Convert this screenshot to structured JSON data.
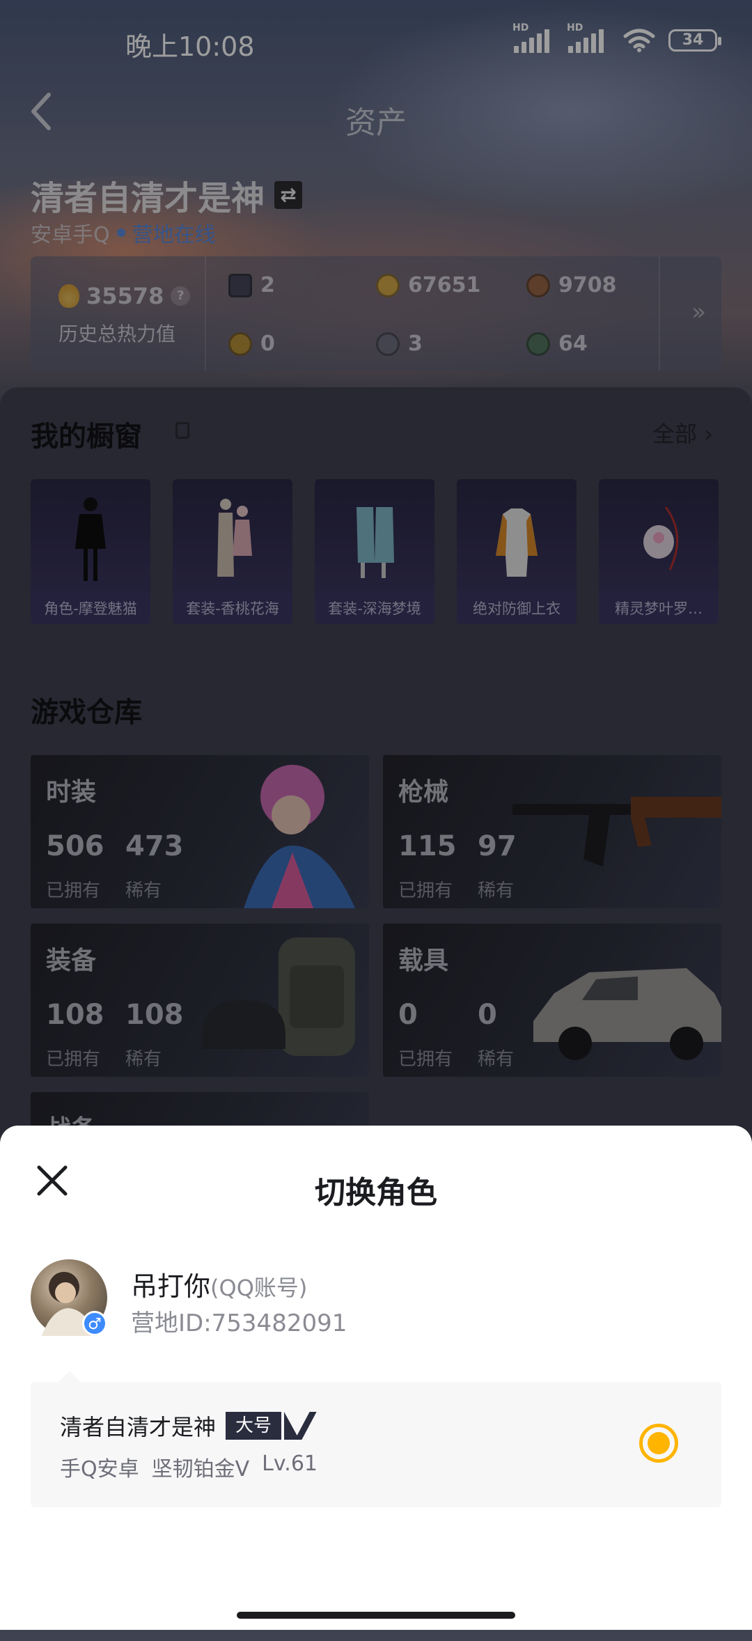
{
  "status_bar": {
    "time": "晚上10:08",
    "battery": "34",
    "sim1": "HD",
    "sim2": "HD"
  },
  "nav": {
    "title": "资产"
  },
  "profile": {
    "name": "清者自清才是神",
    "swap_symbol": "⇄",
    "platform": "安卓手Q",
    "online_status": "营地在线",
    "heat_value": "35578",
    "heat_help": "?",
    "heat_label": "历史总热力值",
    "resources": [
      {
        "icon": "card-icon",
        "value": "2"
      },
      {
        "icon": "gold-coin-icon",
        "value": "67651"
      },
      {
        "icon": "bronze-coin-icon",
        "value": "9708"
      },
      {
        "icon": "badge-coin-icon",
        "value": "0"
      },
      {
        "icon": "silver-coin-icon",
        "value": "3"
      },
      {
        "icon": "green-orb-icon",
        "value": "64"
      }
    ],
    "more_symbol": "»"
  },
  "showcase": {
    "title": "我的橱窗",
    "all_label": "全部",
    "all_chevron": "›",
    "items": [
      {
        "label": "角色-摩登魅猫"
      },
      {
        "label": "套装-香桃花海"
      },
      {
        "label": "套装-深海梦境"
      },
      {
        "label": "绝对防御上衣"
      },
      {
        "label": "精灵梦叶罗…"
      }
    ]
  },
  "warehouse": {
    "title": "游戏仓库",
    "owned_label": "已拥有",
    "rare_label": "稀有",
    "cards": [
      {
        "title": "时装",
        "owned": "506",
        "rare": "473"
      },
      {
        "title": "枪械",
        "owned": "115",
        "rare": "97"
      },
      {
        "title": "装备",
        "owned": "108",
        "rare": "108"
      },
      {
        "title": "载具",
        "owned": "0",
        "rare": "0"
      },
      {
        "title": "战备"
      }
    ]
  },
  "sheet": {
    "title": "切换角色",
    "account_name": "吊打你",
    "account_type": "(QQ账号)",
    "camp_id": "营地ID:753482091",
    "gender_symbol": "♂",
    "role": {
      "name": "清者自清才是神",
      "badge": "大号",
      "platform": "手Q安卓",
      "rank": "坚韧铂金V",
      "level": "Lv.61"
    }
  },
  "colors": {
    "accent": "#ffb400",
    "online": "#3b8cff",
    "badge_bg": "#2a2d3e"
  }
}
